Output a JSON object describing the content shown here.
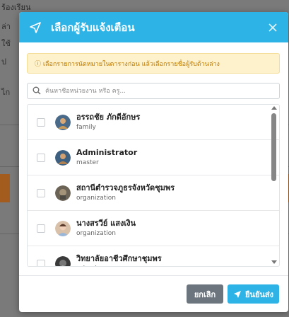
{
  "background": {
    "lines": [
      "ร้องเรียน",
      "ล่า",
      "ใช้",
      "ป",
      "ไก"
    ]
  },
  "modal": {
    "title": "เลือกผู้รับแจ้งเตือน",
    "alert": "ⓘ เลือกรายการนัดหมายในตารางก่อน แล้วเลือกรายชื่อผู้รับด้านล่าง",
    "search_placeholder": "ค้นหาชื่อหน่วยงาน หรือ ครู...",
    "items": [
      {
        "name": "อรรถชัย ภักดีอักษร",
        "type": "family",
        "avatar_color": "#c89a5a"
      },
      {
        "name": "Administrator",
        "type": "master",
        "avatar_color": "#b08050"
      },
      {
        "name": "สถานีตำรวจภูธรจังหวัดชุมพร",
        "type": "organization",
        "avatar_color": "#8a7d6a"
      },
      {
        "name": "นางสรวีย์ แสงเงิน",
        "type": "organization",
        "avatar_color": "#d4a98a"
      },
      {
        "name": "วิทยาลัยอาชีวศึกษาชุมพร",
        "type": "school",
        "avatar_color": "#5a5a5a"
      }
    ],
    "cancel_label": "ยกเลิก",
    "confirm_label": "ยืนยันส่ง"
  },
  "colors": {
    "header": "#2eb3e6",
    "alert_bg": "#fdf2cc",
    "alert_text": "#c07a00",
    "cancel_bg": "#6c757d"
  }
}
